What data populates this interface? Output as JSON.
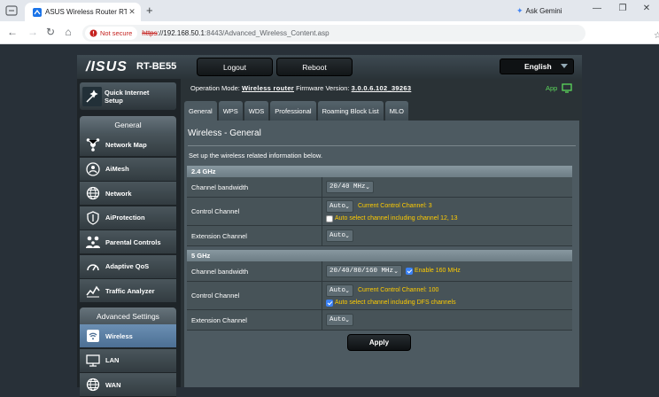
{
  "browser": {
    "tab_title": "ASUS Wireless Router RT-BE55",
    "new_tab": "+",
    "gemini": "Ask Gemini",
    "security": "Not secure",
    "url_scheme": "https",
    "url_host": "://192.168.50.1",
    "url_rest": ":8443/Advanced_Wireless_Content.asp"
  },
  "router": {
    "brand": "/ISUS",
    "model": "RT-BE55",
    "logout": "Logout",
    "reboot": "Reboot",
    "language": "English"
  },
  "sidebar": {
    "quick_setup": "Quick Internet Setup",
    "general_header": "General",
    "general_items": [
      {
        "label": "Network Map",
        "icon": "network-map-icon"
      },
      {
        "label": "AiMesh",
        "icon": "aimesh-icon"
      },
      {
        "label": "Network",
        "icon": "globe-icon"
      },
      {
        "label": "AiProtection",
        "icon": "shield-icon"
      },
      {
        "label": "Parental Controls",
        "icon": "family-icon"
      },
      {
        "label": "Adaptive QoS",
        "icon": "gauge-icon"
      },
      {
        "label": "Traffic Analyzer",
        "icon": "chart-icon"
      }
    ],
    "advanced_header": "Advanced Settings",
    "advanced_items": [
      {
        "label": "Wireless",
        "icon": "wifi-icon",
        "active": true
      },
      {
        "label": "LAN",
        "icon": "lan-icon"
      },
      {
        "label": "WAN",
        "icon": "globe-icon"
      }
    ]
  },
  "status": {
    "op_label": "Operation Mode:",
    "op_value": "Wireless router",
    "fw_label": "Firmware Version:",
    "fw_value": "3.0.0.6.102_39263",
    "app": "App"
  },
  "tabs": [
    "General",
    "WPS",
    "WDS",
    "Professional",
    "Roaming Block List",
    "MLO"
  ],
  "content": {
    "title": "Wireless - General",
    "description": "Set up the wireless related information below.",
    "band24": {
      "header": "2.4 GHz",
      "bw_label": "Channel bandwidth",
      "bw_value": "20/40 MHz",
      "ctrl_label": "Control Channel",
      "ctrl_value": "Auto",
      "ctrl_current": "Current Control Channel: 3",
      "ctrl_check": "Auto select channel including channel 12, 13",
      "ext_label": "Extension Channel",
      "ext_value": "Auto"
    },
    "band5": {
      "header": "5 GHz",
      "bw_label": "Channel bandwidth",
      "bw_value": "20/40/80/160 MHz",
      "bw_check": "Enable 160 MHz",
      "ctrl_label": "Control Channel",
      "ctrl_value": "Auto",
      "ctrl_current": "Current Control Channel: 100",
      "ctrl_check": "Auto select channel including DFS channels",
      "ext_label": "Extension Channel",
      "ext_value": "Auto"
    },
    "apply": "Apply"
  },
  "colors": {
    "accent_yellow": "#ffcc00",
    "app_green": "#5cd85c",
    "active_menu": "#6b8fb3"
  }
}
